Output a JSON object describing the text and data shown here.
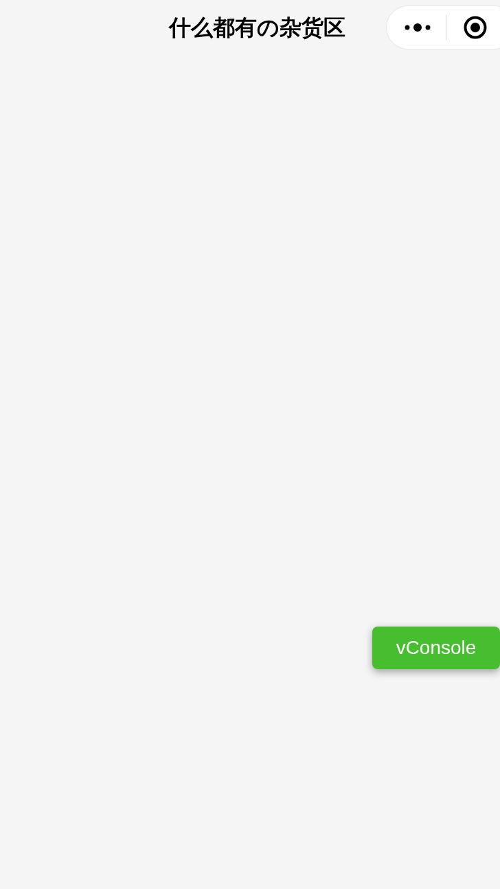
{
  "nav_bar": {
    "title": "什么都有の杂货区"
  },
  "vconsole_button": {
    "label": "vConsole"
  }
}
